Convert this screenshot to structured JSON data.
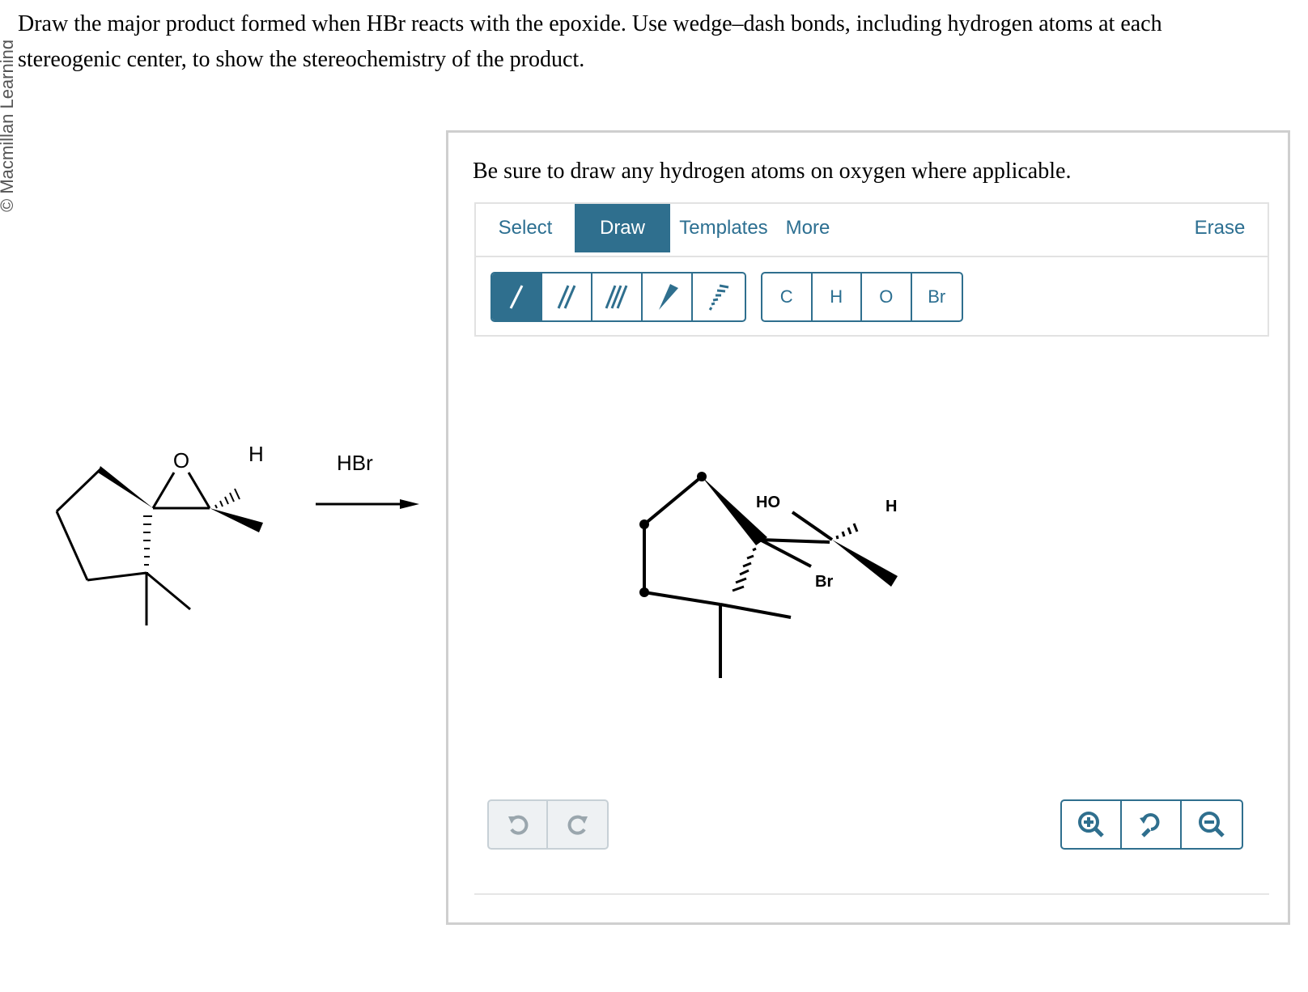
{
  "publisher_watermark": "© Macmillan Learning",
  "question": {
    "line1": "Draw the major product formed when HBr reacts with the epoxide. Use wedge–dash bonds, including hydrogen atoms at each",
    "line2": "stereogenic center, to show the stereochemistry of the product."
  },
  "reaction": {
    "reagent": "HBr",
    "reactant_labels": {
      "oxygen": "O",
      "hydrogen": "H"
    }
  },
  "panel": {
    "instruction": "Be sure to draw any hydrogen atoms on oxygen where applicable.",
    "tabs": [
      {
        "label": "Select",
        "active": false
      },
      {
        "label": "Draw",
        "active": true
      },
      {
        "label": "Templates",
        "active": false
      },
      {
        "label": "More",
        "active": false
      }
    ],
    "erase_label": "Erase",
    "bond_tools": [
      "single-bond",
      "double-bond",
      "triple-bond",
      "wedge-bond",
      "dash-bond"
    ],
    "selected_bond_tool": "single-bond",
    "atom_tools": [
      "C",
      "H",
      "O",
      "Br"
    ],
    "canvas_labels": {
      "hydroxyl": "HO",
      "hydrogen": "H",
      "bromine": "Br"
    },
    "history_buttons": [
      "undo",
      "redo"
    ],
    "zoom_buttons": [
      "zoom-in",
      "zoom-reset",
      "zoom-out"
    ]
  },
  "colors": {
    "accent": "#2f6f8e",
    "border": "#cfcfcf",
    "disabled": "#c7d0d6"
  }
}
